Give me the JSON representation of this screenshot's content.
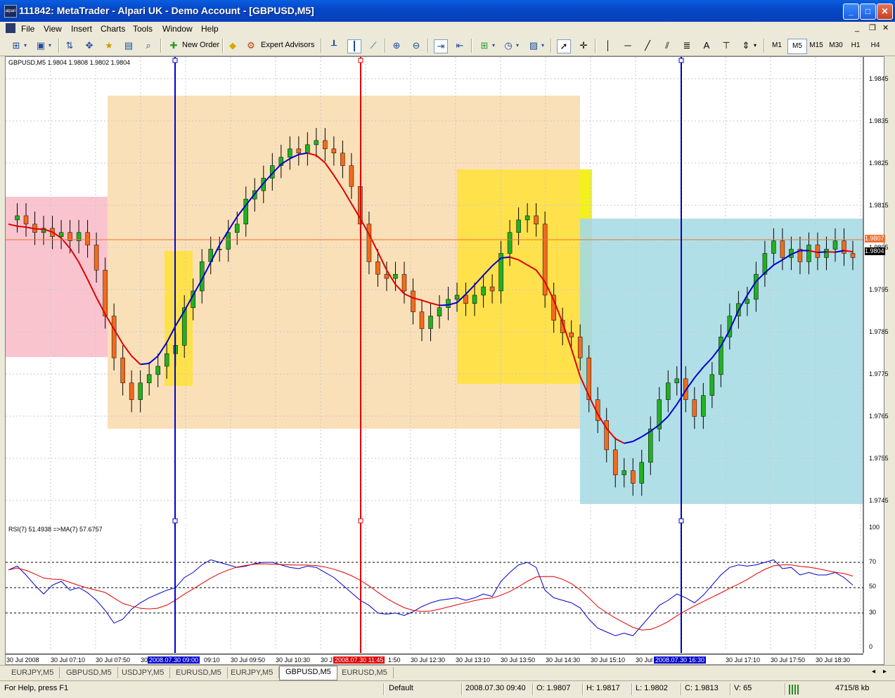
{
  "window": {
    "title": "111842: MetaTrader - Alpari UK - Demo Account - [GBPUSD,M5]",
    "app_icon_text": "alpari"
  },
  "menu": [
    "File",
    "View",
    "Insert",
    "Charts",
    "Tools",
    "Window",
    "Help"
  ],
  "toolbar": {
    "new_order": "New Order",
    "expert_advisors": "Expert Advisors",
    "timeframes": [
      "M1",
      "M5",
      "M15",
      "M30",
      "H1",
      "H4"
    ],
    "active_timeframe": "M5",
    "text_tool": "A"
  },
  "chart": {
    "header": "GBPUSD,M5  1.9804 1.9808 1.9802 1.9804",
    "price_labels": [
      "1.9845",
      "1.9835",
      "1.9825",
      "1.9815",
      "1.9805",
      "1.9795",
      "1.9785",
      "1.9775",
      "1.9765",
      "1.9755",
      "1.9745"
    ],
    "ask_label": "1.9807",
    "bid_label": "1.9804",
    "rsi_header": "RSI(7) 51.4938  =>MA(7) 57.6757",
    "rsi_labels": [
      "100",
      "70",
      "50",
      "30",
      "0"
    ],
    "time_labels": [
      "30 Jul 2008",
      "30 Jul 07:10",
      "30 Jul 07:50",
      "30",
      "09:10",
      "30 Jul 09:50",
      "30 Jul 10:30",
      "30 J",
      "1:50",
      "30 Jul 12:30",
      "30 Jul 13:10",
      "30 Jul 13:50",
      "30 Jul 14:30",
      "30 Jul 15:10",
      "30 Jul",
      "30 Jul 17:10",
      "30 Jul 17:50",
      "30 Jul 18:30"
    ],
    "vline_labels": [
      "2008.07.30 09:00",
      "2008.07.30 11:45",
      "2008.07.30 16:30"
    ],
    "colors": {
      "bull": "#22B022",
      "bear": "#F26B1D",
      "ma_up": "#0000CC",
      "ma_down": "#E00000",
      "rsi": "#0000CC",
      "rsi_ma": "#E00000"
    }
  },
  "chart_data": {
    "type": "line",
    "title": "GBPUSD,M5",
    "xlabel": "",
    "ylabel": "",
    "ylim": [
      1.9741,
      1.9852
    ],
    "series": [
      {
        "name": "",
        "values": [
          1.9813,
          1.9814,
          1.9812,
          1.981,
          1.9811,
          1.9809,
          1.981,
          1.9808,
          1.981,
          1.9807,
          1.9801,
          1.979,
          1.978,
          1.9774,
          1.977,
          1.9774,
          1.9776,
          1.9778,
          1.9781,
          1.9783,
          1.9792,
          1.9796,
          1.9803,
          1.9806,
          1.9806,
          1.981,
          1.9812,
          1.9818,
          1.982,
          1.9823,
          1.9826,
          1.9828,
          1.983,
          1.9829,
          1.9831,
          1.9832,
          1.983,
          1.9829,
          1.9826,
          1.9821,
          1.9812,
          1.9803,
          1.98,
          1.9799,
          1.98,
          1.9796,
          1.9791,
          1.9787,
          1.979,
          1.9792,
          1.9794,
          1.9795,
          1.9793,
          1.9795,
          1.9797,
          1.9796,
          1.9805,
          1.981,
          1.9813,
          1.9814,
          1.9812,
          1.9795,
          1.9789,
          1.9786,
          1.9785,
          1.978,
          1.977,
          1.9765,
          1.9758,
          1.9752,
          1.9753,
          1.975,
          1.9755,
          1.9763,
          1.977,
          1.9774,
          1.9775,
          1.977,
          1.9766,
          1.9771,
          1.9776,
          1.9785,
          1.979,
          1.9793,
          1.9794,
          1.98,
          1.9805,
          1.9808,
          1.9804,
          1.9806,
          1.9803,
          1.9807,
          1.9804,
          1.9806,
          1.9808,
          1.9805,
          1.9804
        ]
      },
      {
        "name": "",
        "values": [
          64,
          67,
          60,
          52,
          45,
          52,
          55,
          48,
          50,
          46,
          40,
          32,
          22,
          25,
          33,
          38,
          42,
          45,
          48,
          50,
          58,
          62,
          68,
          72,
          70,
          68,
          66,
          67,
          69,
          70,
          70,
          68,
          66,
          65,
          67,
          66,
          62,
          58,
          52,
          46,
          40,
          36,
          30,
          29,
          30,
          28,
          31,
          35,
          38,
          40,
          41,
          42,
          40,
          42,
          45,
          43,
          55,
          62,
          68,
          70,
          66,
          48,
          42,
          40,
          38,
          34,
          25,
          18,
          15,
          12,
          14,
          12,
          20,
          28,
          36,
          40,
          45,
          42,
          38,
          44,
          52,
          60,
          66,
          68,
          67,
          68,
          70,
          72,
          65,
          66,
          60,
          62,
          60,
          60,
          62,
          58,
          52
        ]
      }
    ]
  },
  "tabs": [
    "EURJPY,M5",
    "GBPUSD,M5",
    "USDJPY,M5",
    "EURUSD,M5",
    "EURJPY,M5",
    "GBPUSD,M5",
    "EURUSD,M5"
  ],
  "active_tab_index": 5,
  "status": {
    "help": "For Help, press F1",
    "profile": "Default",
    "datetime": "2008.07.30 09:40",
    "open": "O: 1.9807",
    "high": "H: 1.9817",
    "low": "L: 1.9802",
    "close": "C: 1.9813",
    "volume": "V: 65",
    "traffic": "4715/8 kb"
  }
}
